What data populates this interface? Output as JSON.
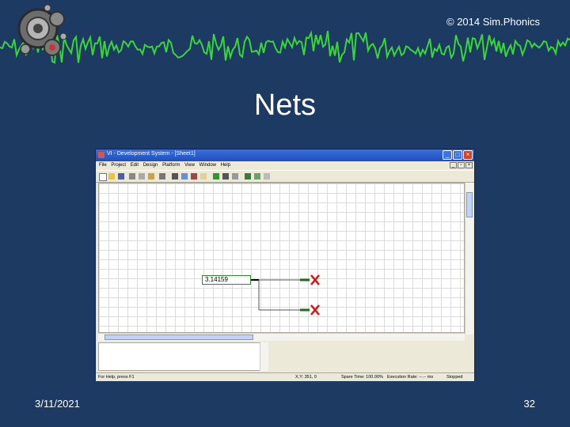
{
  "slide": {
    "copyright": "© 2014 Sim.Phonics",
    "title": "Nets",
    "date": "3/11/2021",
    "page_number": "32"
  },
  "window": {
    "title": "VI - Development System - [Sheet1]",
    "menus": [
      "File",
      "Project",
      "Edit",
      "Design",
      "Platform",
      "View",
      "Window",
      "Help"
    ],
    "value_box": "3.14159",
    "status": {
      "help": "For Help, press F1",
      "coords": "X,Y: 351, 0",
      "spare_time": "Spare Time: 100.00%",
      "exec_rate": "Execution Rate: --.-- ms",
      "state": "Stopped"
    }
  },
  "colors": {
    "slide_bg": "#1d3a63",
    "waveform": "#39d639",
    "net_terminal": "#1a6e1a",
    "unconnected_x": "#e01010"
  }
}
